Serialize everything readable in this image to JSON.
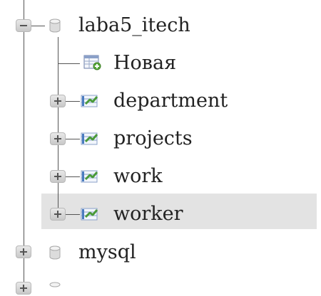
{
  "tree": {
    "databases": [
      {
        "name": "laba5_itech",
        "expanded": true,
        "icon": "database-icon"
      },
      {
        "name": "mysql",
        "expanded": false,
        "icon": "database-icon"
      }
    ],
    "new_item": {
      "label": "Новая",
      "icon": "new-table-icon"
    },
    "tables": [
      {
        "name": "department",
        "icon": "table-icon"
      },
      {
        "name": "projects",
        "icon": "table-icon"
      },
      {
        "name": "work",
        "icon": "table-icon"
      },
      {
        "name": "worker",
        "icon": "table-icon",
        "highlighted": true
      }
    ]
  },
  "colors": {
    "highlight": "#e3e3e3",
    "tree_line": "#555555",
    "table_icon_green": "#4a9a3a",
    "table_icon_blue": "#4a7cc0"
  }
}
